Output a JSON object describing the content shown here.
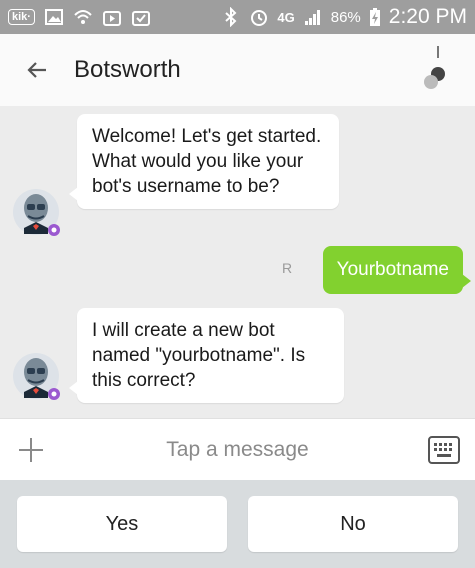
{
  "status_bar": {
    "app_badge": "kik·",
    "network": "4G",
    "battery_percent": "86%",
    "time": "2:20 PM"
  },
  "header": {
    "title": "Botsworth"
  },
  "messages": [
    {
      "sender": "bot",
      "text": "Welcome! Let's get started. What would you like your bot's username to be?"
    },
    {
      "sender": "user",
      "text": "Yourbotname",
      "receipt": "R"
    },
    {
      "sender": "bot",
      "text": "I will create a new bot named \"yourbotname\". Is this correct?"
    }
  ],
  "composer": {
    "placeholder": "Tap a message"
  },
  "suggested_responses": [
    "Yes",
    "No"
  ],
  "colors": {
    "status_bar": "#9e9e9e",
    "header": "#fafafa",
    "conversation_bg": "#ececec",
    "outgoing_bubble": "#82d12f",
    "suggest_bar": "#d8dcde"
  }
}
